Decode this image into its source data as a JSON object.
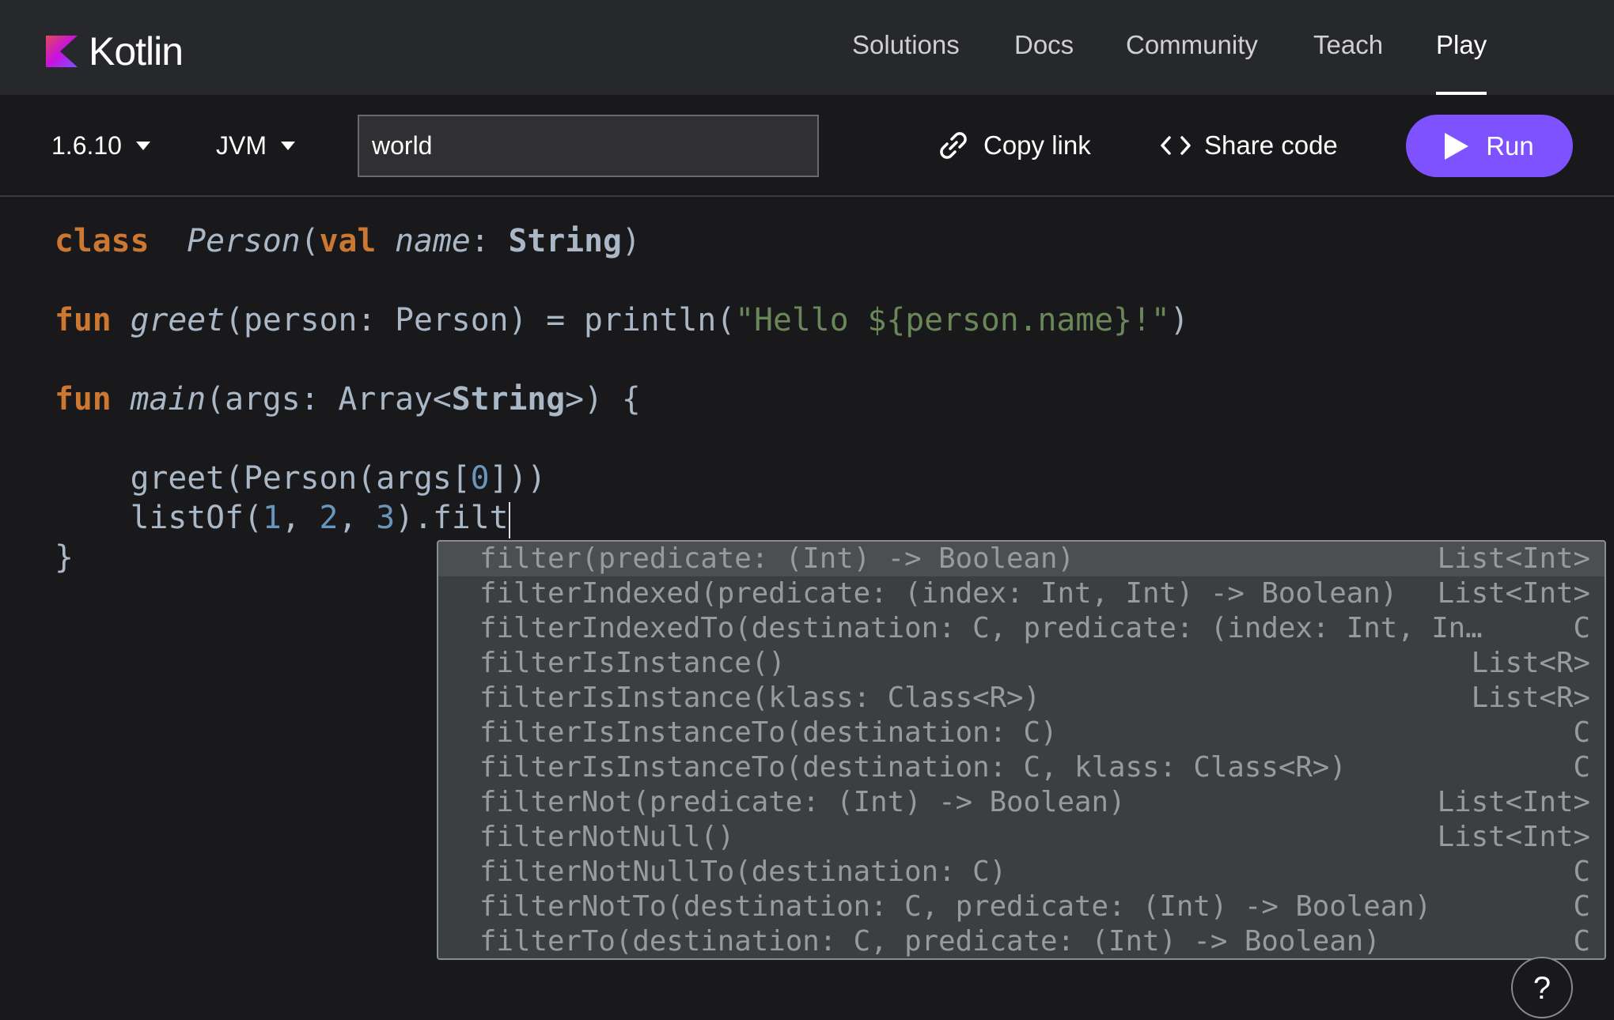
{
  "header": {
    "logo": "Kotlin",
    "nav": [
      "Solutions",
      "Docs",
      "Community",
      "Teach",
      "Play"
    ],
    "active_nav": "Play"
  },
  "toolbar": {
    "version": "1.6.10",
    "platform": "JVM",
    "args_value": "world",
    "copy_link": "Copy link",
    "share_code": "Share code",
    "run": "Run"
  },
  "code": [
    [
      [
        "kw",
        "class"
      ],
      [
        "",
        "  "
      ],
      [
        "fn",
        "Person"
      ],
      [
        "",
        "("
      ],
      [
        "kw",
        "val"
      ],
      [
        "",
        " "
      ],
      [
        "fn",
        "name"
      ],
      [
        "",
        ": "
      ],
      [
        "type",
        "String"
      ],
      [
        "",
        ")"
      ]
    ],
    [],
    [
      [
        "kw",
        "fun"
      ],
      [
        "",
        " "
      ],
      [
        "fn",
        "greet"
      ],
      [
        "",
        "(person: Person) = println("
      ],
      [
        "str",
        "\"Hello ${person.name}!\""
      ],
      [
        "",
        ")"
      ]
    ],
    [],
    [
      [
        "kw",
        "fun"
      ],
      [
        "",
        " "
      ],
      [
        "fn",
        "main"
      ],
      [
        "",
        "(args: Array<"
      ],
      [
        "type",
        "String"
      ],
      [
        "",
        ">) {"
      ]
    ],
    [],
    [
      [
        "",
        "    greet(Person(args["
      ],
      [
        "num",
        "0"
      ],
      [
        "",
        "]))"
      ]
    ],
    [
      [
        "",
        "    listOf("
      ],
      [
        "num",
        "1"
      ],
      [
        "",
        ", "
      ],
      [
        "num",
        "2"
      ],
      [
        "",
        ", "
      ],
      [
        "num",
        "3"
      ],
      [
        "",
        ").filt"
      ]
    ],
    [
      [
        "",
        "}"
      ]
    ]
  ],
  "completion": [
    {
      "label": "filter(predicate: (Int) -> Boolean)",
      "type": "List<Int>"
    },
    {
      "label": "filterIndexed(predicate: (index: Int, Int) -> Boolean)",
      "type": "List<Int>"
    },
    {
      "label": "filterIndexedTo(destination: C, predicate: (index: Int, In…",
      "type": "C"
    },
    {
      "label": "filterIsInstance()",
      "type": "List<R>"
    },
    {
      "label": "filterIsInstance(klass: Class<R>)",
      "type": "List<R>"
    },
    {
      "label": "filterIsInstanceTo(destination: C)",
      "type": "C"
    },
    {
      "label": "filterIsInstanceTo(destination: C, klass: Class<R>)",
      "type": "C"
    },
    {
      "label": "filterNot(predicate: (Int) -> Boolean)",
      "type": "List<Int>"
    },
    {
      "label": "filterNotNull()",
      "type": "List<Int>"
    },
    {
      "label": "filterNotNullTo(destination: C)",
      "type": "C"
    },
    {
      "label": "filterNotTo(destination: C, predicate: (Int) -> Boolean)",
      "type": "C"
    },
    {
      "label": "filterTo(destination: C, predicate: (Int) -> Boolean)",
      "type": "C"
    }
  ],
  "help": "?",
  "colors": {
    "accent": "#7f52ff",
    "keyword": "#cc7832",
    "string": "#6a8759",
    "number": "#6897bb"
  }
}
